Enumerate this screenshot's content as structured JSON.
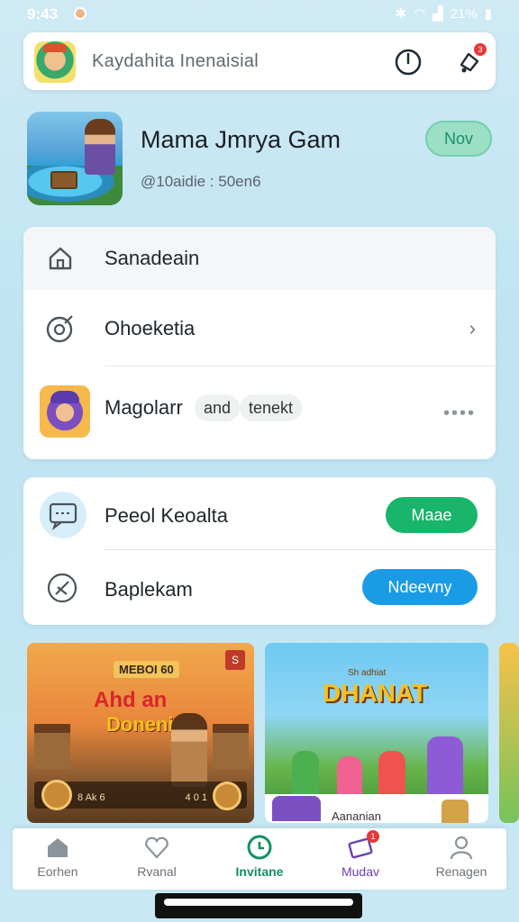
{
  "status_bar": {
    "time": "9:43",
    "battery": "21%"
  },
  "search": {
    "placeholder": "Kaydahita Inenaisial"
  },
  "notifications": {
    "badge": "3"
  },
  "game": {
    "title": "Mama Jmrya Gam",
    "subtitle": "@10aidie : 50en6",
    "now_label": "Nov"
  },
  "menu": {
    "items": [
      {
        "label": "Sanadeain",
        "icon": "home-icon"
      },
      {
        "label": "Ohoeketia",
        "icon": "target-icon"
      },
      {
        "label": "Magolarr",
        "icon": "character-avatar",
        "tags": [
          "and",
          "tenekt"
        ]
      }
    ]
  },
  "actions": {
    "row1": {
      "label": "Peeol Keoalta",
      "button": "Maae",
      "button_color": "#18b56b"
    },
    "row2": {
      "label": "Baplekam",
      "button": "Ndeevny",
      "button_color": "#1a9be6"
    }
  },
  "banners": {
    "first": {
      "top_label": "MEBOI 60",
      "corner": "S",
      "logo_line1": "Ahd an",
      "logo_line2": "Doneni",
      "stat_left": "8 Ak 6",
      "stat_right": "4 0 1"
    },
    "second": {
      "logo": "DHANAT",
      "sub": "Sh adhiat",
      "caption": "Aananian"
    }
  },
  "bottom_nav": {
    "items": [
      {
        "label": "Eorhen",
        "icon": "home-icon"
      },
      {
        "label": "Rvanal",
        "icon": "heart-icon"
      },
      {
        "label": "Invitane",
        "icon": "clock-icon"
      },
      {
        "label": "Mudav",
        "icon": "ticket-icon",
        "badge": "1"
      },
      {
        "label": "Renagen",
        "icon": "user-icon"
      }
    ],
    "active_index": 2
  },
  "colors": {
    "accent_green": "#18b56b",
    "accent_blue": "#1a9be6",
    "active_nav": "#11915f",
    "purple": "#6c3fb3"
  }
}
